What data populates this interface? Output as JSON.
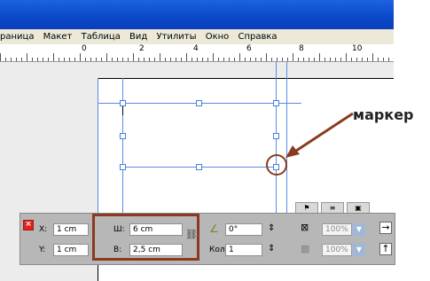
{
  "menu": {
    "items": [
      "раница",
      "Макет",
      "Таблица",
      "Вид",
      "Утилиты",
      "Окно",
      "Справка"
    ]
  },
  "ruler": {
    "labels": [
      "0",
      "2",
      "4",
      "6",
      "8",
      "10"
    ]
  },
  "callout": {
    "label": "маркер"
  },
  "panel": {
    "x_label": "X:",
    "x_value": "1 cm",
    "y_label": "Y:",
    "y_value": "1 cm",
    "w_label": "Ш:",
    "w_value": "6 cm",
    "h_label": "В:",
    "h_value": "2,5 cm",
    "angle_value": "0°",
    "columns_label": "Кол:",
    "columns_value": "1",
    "opacity_1": "100%",
    "opacity_2": "100%"
  },
  "colors": {
    "title_bar": "#0a47c9",
    "guide": "#5b8be6",
    "highlight": "#8b3a1f",
    "panel_bg": "#b7b7b7"
  }
}
